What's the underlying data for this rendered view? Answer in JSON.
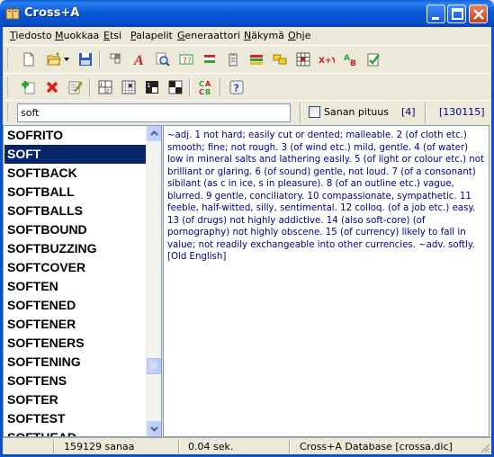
{
  "window": {
    "title": "Cross+A"
  },
  "menu": [
    "Tiedosto",
    "Muokkaa",
    "Etsi",
    "Palapelit",
    "Generaattori",
    "Näkymä",
    "Ohje"
  ],
  "toolbar1_icons": [
    "new-file-icon",
    "open-folder-icon",
    "dropdown-arrow-icon",
    "save-icon",
    "grid-icon",
    "font-a-icon",
    "find-icon",
    "question-box-icon",
    "flag-icon",
    "clipboard-icon",
    "color-bars-icon",
    "yellow-tags-icon",
    "word-grid-icon",
    "x-plus-y-icon",
    "spell-check-icon",
    "checklist-icon"
  ],
  "toolbar2_icons": [
    "add-icon",
    "delete-icon",
    "edit-icon",
    "number-grid-icon",
    "grid-pattern-icon",
    "numbered-block-icon",
    "checkerboard-icon",
    "cipher-icon",
    "help-icon"
  ],
  "search": {
    "value": "soft",
    "length_label": "Sanan pituus",
    "length_value": "[4]",
    "total": "[130115]"
  },
  "words": [
    "SOFRITO",
    "SOFT",
    "SOFTBACK",
    "SOFTBALL",
    "SOFTBALLS",
    "SOFTBOUND",
    "SOFTBUZZING",
    "SOFTCOVER",
    "SOFTEN",
    "SOFTENED",
    "SOFTENER",
    "SOFTENERS",
    "SOFTENING",
    "SOFTENS",
    "SOFTER",
    "SOFTEST",
    "SOFTHEAD"
  ],
  "selected_word": "SOFT",
  "definition": "~adj. 1 not hard; easily cut or dented; malleable. 2 (of cloth etc.) smooth; fine; not rough. 3 (of wind etc.) mild, gentle. 4 (of water) low in mineral salts and lathering easily. 5 (of light or colour etc.) not brilliant or glaring. 6 (of sound) gentle, not loud. 7 (of a consonant) sibilant (as c in ice, s in pleasure). 8 (of an outline etc.) vague, blurred. 9 gentle, conciliatory. 10 compassionate, sympathetic. 11 feeble, half-witted, silly, sentimental. 12 colloq. (of a job etc.) easy. 13 (of drugs) not highly addictive. 14 (also soft-core) (of pornography) not highly obscene. 15 (of currency) likely to fall in value; not readily exchangeable into other currencies. ~adv. softly. [Old English]",
  "status": {
    "count": "159129 sanaa",
    "time": "0.04 sek.",
    "db": "Cross+A Database [crossa.dic]"
  },
  "colors": {
    "selection": "#0a246a",
    "definition_text": "#00008b",
    "titlebar": "#0a58d8"
  }
}
